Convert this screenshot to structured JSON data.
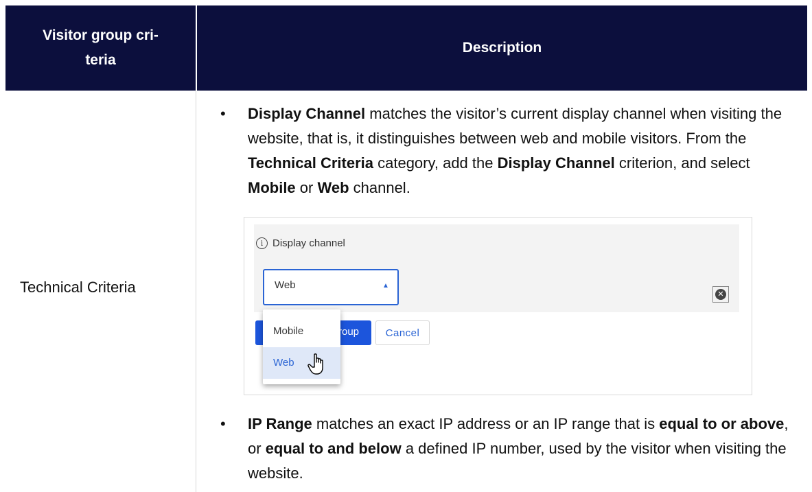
{
  "table": {
    "headers": [
      "Visitor group cri-\nteria",
      "Description"
    ],
    "row_label": "Technical Criteria"
  },
  "bullet1": {
    "t1": "Display Channel",
    "t2": " matches the visitor’s current display channel when visiting the website, that is, it distinguishes between web and mobile vis­itors. From the ",
    "t3": "Technical Criteria",
    "t4": " category, add the ",
    "t5": "Display Channel",
    "t6": " criterion, and select ",
    "t7": "Mobile",
    "t8": " or ",
    "t9": "Web",
    "t10": " channel."
  },
  "screenshot": {
    "field_label": "Display channel",
    "select_value": "Web",
    "options": [
      "Mobile",
      "Web"
    ],
    "primary_button_visible": "roup",
    "cancel_button": "Cancel",
    "info_icon": "info-icon",
    "clear_icon": "clear-icon"
  },
  "bullet2": {
    "t1": "IP Range",
    "t2": " matches an exact IP address or an IP range that is ",
    "t3": "equal to or above",
    "t4": ", or ",
    "t5": "equal to and below",
    "t6": " a defined IP number, used by the vis­itor when visiting the website."
  },
  "colors": {
    "header_bg": "#0c0f3d",
    "accent": "#2a64d4",
    "primary_button": "#1c55dc"
  }
}
